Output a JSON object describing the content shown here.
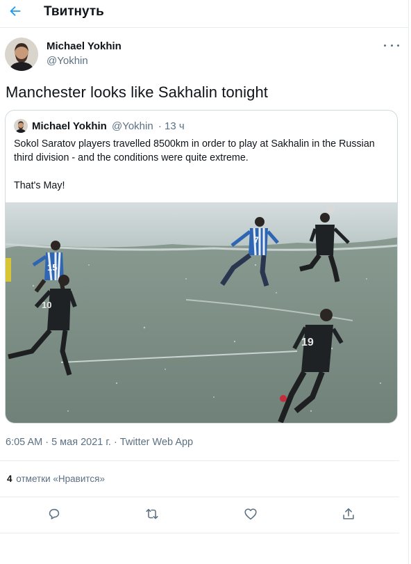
{
  "header": {
    "title": "Твитнуть"
  },
  "tweet": {
    "author_name": "Michael Yokhin",
    "author_handle": "@Yokhin",
    "text": "Manchester looks like Sakhalin tonight",
    "timestamp": "6:05 AM · 5 мая 2021 г. · Twitter Web App",
    "likes_count": "4",
    "likes_label": "отметки «Нравится»"
  },
  "quote": {
    "author_name": "Michael Yokhin",
    "author_handle": "@Yokhin",
    "time_ago": "· 13 ч",
    "text_p1": "Sokol Saratov players travelled 8500km in order to play at Sakhalin in the Russian third division - and the conditions were quite extreme.",
    "text_p2": "That's May!",
    "image_jersey_numbers": [
      "15",
      "10",
      "7",
      "19"
    ]
  },
  "colors": {
    "accent": "#1d9bf0",
    "secondary_text": "#5b7083",
    "border": "#cfd9de"
  },
  "icons": [
    "back-arrow-icon",
    "more-icon",
    "reply-icon",
    "retweet-icon",
    "like-icon",
    "share-icon"
  ]
}
